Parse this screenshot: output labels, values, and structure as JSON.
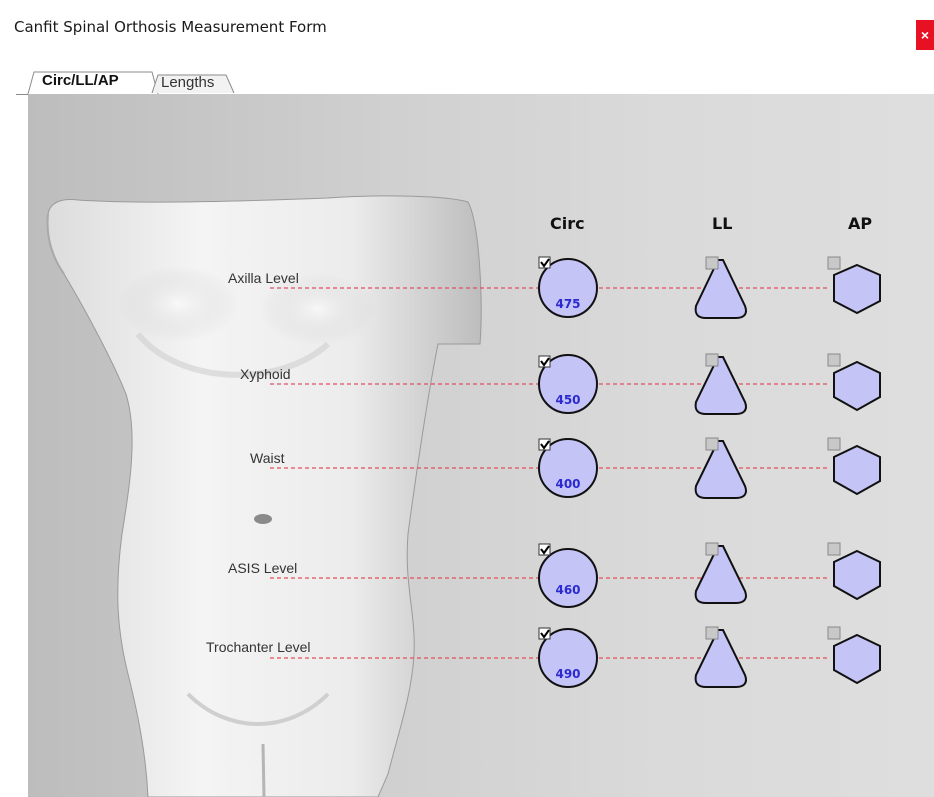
{
  "window": {
    "title": "Canfit Spinal Orthosis Measurement Form",
    "close_label": "×"
  },
  "tabs": [
    {
      "label": "Circ/LL/AP",
      "active": true
    },
    {
      "label": "Lengths",
      "active": false
    }
  ],
  "columns": {
    "circ": "Circ",
    "ll": "LL",
    "ap": "AP"
  },
  "levels": [
    {
      "label": "Axilla Level",
      "circ": "475",
      "circ_checked": true,
      "ll_checked": false,
      "ap_checked": false
    },
    {
      "label": "Xyphoid",
      "circ": "450",
      "circ_checked": true,
      "ll_checked": false,
      "ap_checked": false
    },
    {
      "label": "Waist",
      "circ": "400",
      "circ_checked": true,
      "ll_checked": false,
      "ap_checked": false
    },
    {
      "label": "ASIS Level",
      "circ": "460",
      "circ_checked": true,
      "ll_checked": false,
      "ap_checked": false
    },
    {
      "label": "Trochanter Level",
      "circ": "490",
      "circ_checked": true,
      "ll_checked": false,
      "ap_checked": false
    }
  ],
  "colors": {
    "shape_fill": "#c4c4f6",
    "shape_stroke": "#111111",
    "value_text": "#2a2ad0",
    "guide_line": "#e0505a",
    "close_button": "#e81123"
  }
}
